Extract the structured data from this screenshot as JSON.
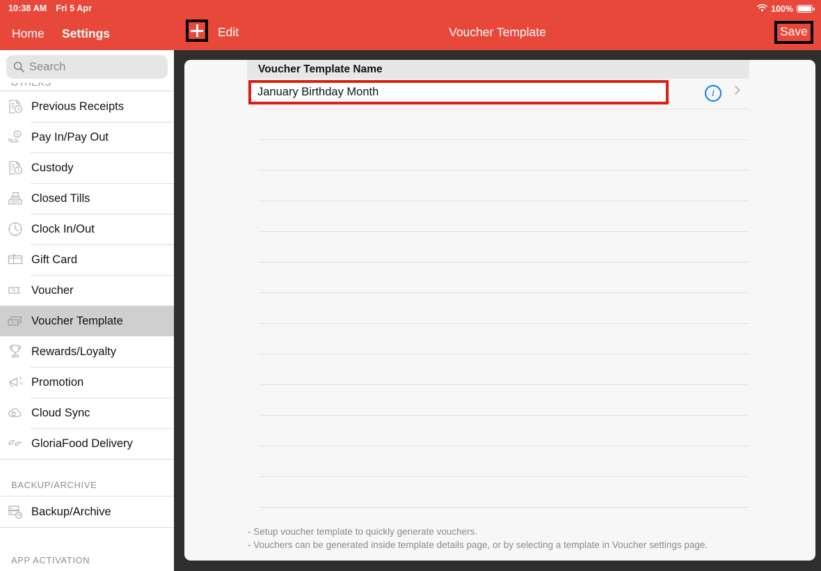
{
  "status_bar": {
    "time": "10:38 AM",
    "date": "Fri 5 Apr",
    "battery_percent": "100%",
    "wifi_icon": "wifi-icon",
    "battery_icon": "battery-full-icon"
  },
  "sidebar": {
    "nav": {
      "back_label": "Home",
      "title": "Settings"
    },
    "search": {
      "placeholder": "Search",
      "value": "",
      "icon": "search-icon"
    },
    "partial_section_header": "OTHERS",
    "items": [
      {
        "label": "Previous Receipts",
        "icon": "receipt-clock-icon",
        "selected": false
      },
      {
        "label": "Pay In/Pay Out",
        "icon": "hand-cash-icon",
        "selected": false
      },
      {
        "label": "Custody",
        "icon": "receipt-clock-icon",
        "selected": false
      },
      {
        "label": "Closed Tills",
        "icon": "cash-register-icon",
        "selected": false
      },
      {
        "label": "Clock In/Out",
        "icon": "clock-icon",
        "selected": false
      },
      {
        "label": "Gift Card",
        "icon": "gift-card-icon",
        "selected": false
      },
      {
        "label": "Voucher",
        "icon": "ticket-icon",
        "selected": false
      },
      {
        "label": "Voucher Template",
        "icon": "ticket-stack-icon",
        "selected": true
      },
      {
        "label": "Rewards/Loyalty",
        "icon": "trophy-icon",
        "selected": false
      },
      {
        "label": "Promotion",
        "icon": "megaphone-icon",
        "selected": false
      },
      {
        "label": "Cloud Sync",
        "icon": "cloud-sync-icon",
        "selected": false
      },
      {
        "label": "GloriaFood Delivery",
        "icon": "leaf-icon",
        "selected": false
      }
    ],
    "groups": [
      {
        "header": "BACKUP/ARCHIVE",
        "items": [
          {
            "label": "Backup/Archive",
            "icon": "server-backup-icon",
            "selected": false
          }
        ]
      },
      {
        "header": "APP ACTIVATION",
        "items": []
      }
    ]
  },
  "topbar": {
    "add_button_icon": "plus-icon",
    "edit_label": "Edit",
    "title": "Voucher Template",
    "save_label": "Save",
    "bg_color": "#e8483a"
  },
  "content": {
    "section_header": "Voucher Template Name",
    "template_name_value": "January Birthday Month",
    "info_icon": "info-circle-icon",
    "disclosure_icon": "chevron-right-icon",
    "empty_row_count": 13,
    "footnotes": [
      "- Setup voucher template to quickly generate vouchers.",
      "- Vouchers can be generated inside template details page, or by selecting a template in Voucher settings page."
    ],
    "highlight_color": "#e01f12",
    "accent_color": "#0a7bf5"
  }
}
